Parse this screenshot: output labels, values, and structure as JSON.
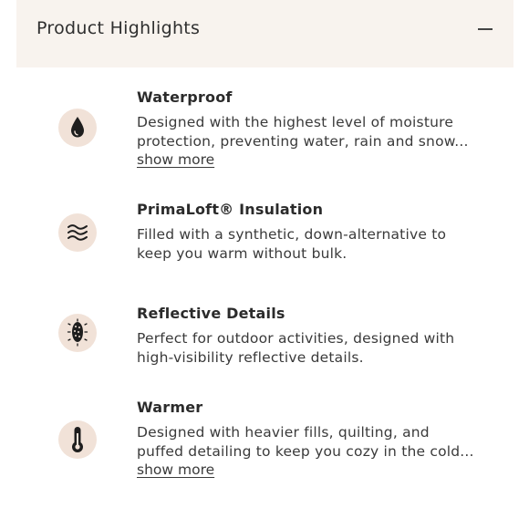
{
  "header": {
    "title": "Product Highlights",
    "toggle_icon": "minus-icon"
  },
  "features": [
    {
      "title": "Waterproof",
      "icon": "water-drop-icon",
      "lines": [
        "Designed with the highest level of moisture",
        "protection, preventing water, rain and snow..."
      ],
      "show_more": "show more"
    },
    {
      "title": "PrimaLoft® Insulation",
      "icon": "wind-waves-icon",
      "lines": [
        "Filled with a synthetic, down-alternative to",
        "keep you warm without bulk."
      ]
    },
    {
      "title": "Reflective Details",
      "icon": "reflective-icon",
      "lines": [
        "Perfect for outdoor activities, designed with",
        "high-visibility reflective details."
      ]
    },
    {
      "title": "Warmer",
      "icon": "thermometer-icon",
      "lines": [
        "Designed with heavier fills, quilting, and",
        "puffed detailing to keep you cozy in the cold..."
      ],
      "show_more": "show more"
    }
  ],
  "colors": {
    "header_bg": "#f8f3ee",
    "icon_bg": "#f1e2d8",
    "text": "#2b2b2b"
  }
}
